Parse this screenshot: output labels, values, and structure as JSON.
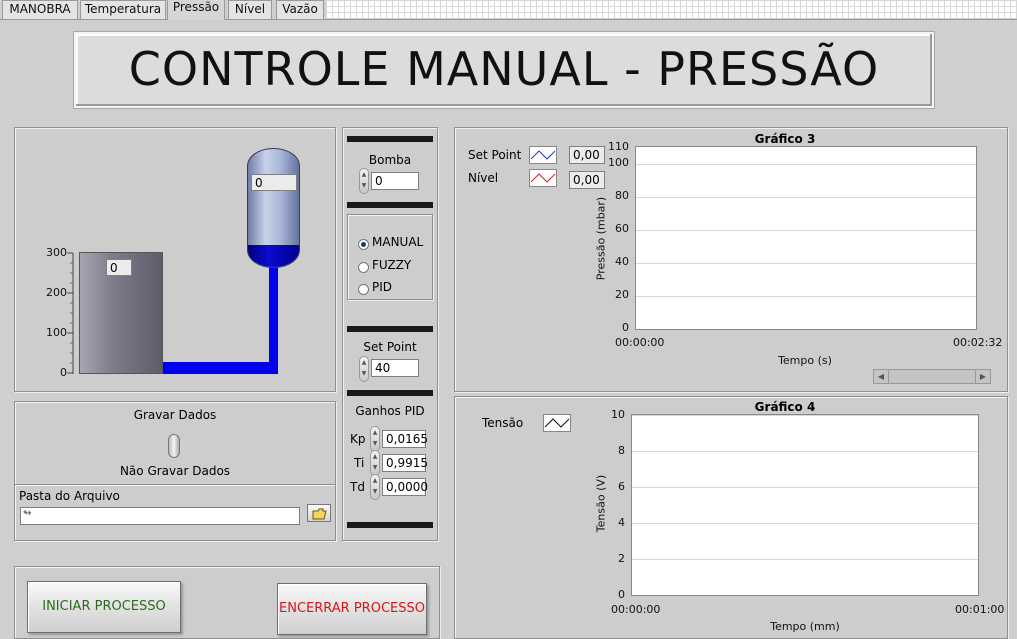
{
  "tabs": [
    {
      "label": "MANOBRA"
    },
    {
      "label": "Temperatura"
    },
    {
      "label": "Pressão"
    },
    {
      "label": "Nível"
    },
    {
      "label": "Vazão"
    }
  ],
  "active_tab": "Pressão",
  "title": "CONTROLE MANUAL - PRESSÃO",
  "tank": {
    "scale_ticks": [
      "300",
      "200",
      "100",
      "0"
    ],
    "tank_value": "0",
    "vessel_value": "0",
    "pipe_color": "#0000ee"
  },
  "bomba": {
    "label": "Bomba",
    "value": "0"
  },
  "modes": [
    {
      "label": "MANUAL",
      "selected": true
    },
    {
      "label": "FUZZY",
      "selected": false
    },
    {
      "label": "PID",
      "selected": false
    }
  ],
  "setpoint": {
    "label": "Set Point",
    "value": "40"
  },
  "pid": {
    "label": "Ganhos PID",
    "gains": [
      {
        "name": "Kp",
        "value": "0,0165"
      },
      {
        "name": "Ti",
        "value": "0,9915"
      },
      {
        "name": "Td",
        "value": "0,0000"
      }
    ]
  },
  "record": {
    "title": "Gravar Dados",
    "state_label": "Não Gravar Dados",
    "folder_label": "Pasta do Arquivo",
    "folder_path": ""
  },
  "buttons": {
    "start": "INICIAR PROCESSO",
    "stop": "ENCERRAR PROCESSO",
    "start_color": "#2d6a1e",
    "stop_color": "#d41818"
  },
  "graph3": {
    "title": "Gráfico 3",
    "legend": [
      {
        "name": "Set Point",
        "value": "0,00",
        "color": "#1f3fbf"
      },
      {
        "name": "Nível",
        "value": "0,00",
        "color": "#d42020"
      }
    ],
    "ylabel": "Pressão (mbar)",
    "xlabel": "Tempo (s)",
    "x_start": "00:00:00",
    "x_end": "00:02:32",
    "ticks": [
      "110",
      "100",
      "80",
      "60",
      "40",
      "20",
      "0"
    ]
  },
  "graph4": {
    "title": "Gráfico 4",
    "legend": [
      {
        "name": "Tensão"
      }
    ],
    "ylabel": "Tensão (V)",
    "xlabel": "Tempo (mm)",
    "x_start": "00:00:00",
    "x_end": "00:01:00",
    "ticks": [
      "10",
      "8",
      "6",
      "4",
      "2",
      "0"
    ]
  }
}
